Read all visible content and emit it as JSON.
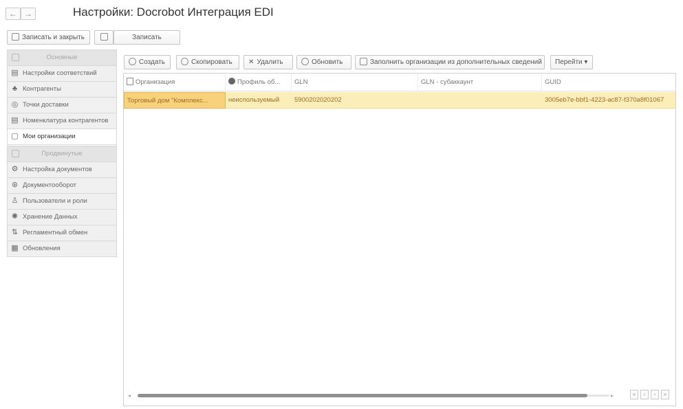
{
  "window": {
    "title": "Настройки: Docrobot Интеграция EDI",
    "back_glyph": "←",
    "forward_glyph": "→"
  },
  "commandbar": {
    "save_close_label": "Записать и закрыть",
    "save_label": "Записать"
  },
  "sidebar": {
    "items": [
      {
        "label": "Основные",
        "icon": "group-icon",
        "kind": "group"
      },
      {
        "label": "Настройки соответствий",
        "icon": "document-icon"
      },
      {
        "label": "Контрагенты",
        "icon": "people-icon"
      },
      {
        "label": "Точки доставки",
        "icon": "location-icon"
      },
      {
        "label": "Номенклатура контрагентов",
        "icon": "document-icon"
      },
      {
        "label": "Мои организации",
        "icon": "document-icon",
        "active": true
      },
      {
        "label": "Продвинутые",
        "icon": "group-icon",
        "kind": "group"
      },
      {
        "label": "Настройка документов",
        "icon": "document-settings-icon"
      },
      {
        "label": "Документооборот",
        "icon": "gear-icon"
      },
      {
        "label": "Пользователи и роли",
        "icon": "user-icon"
      },
      {
        "label": "Хранение Данных",
        "icon": "database-icon"
      },
      {
        "label": "Регламентный обмен",
        "icon": "exchange-icon"
      },
      {
        "label": "Обновления",
        "icon": "update-icon"
      }
    ]
  },
  "toolbar": {
    "create_label": "Создать",
    "copy_label": "Скопировать",
    "delete_label": "Удалить",
    "refresh_label": "Обновить",
    "fill_label": "Заполнить организации из дополнительных сведений",
    "goto_label": "Перейти ▾"
  },
  "table": {
    "columns": [
      "Организация",
      "Профиль об...",
      "GLN",
      "GLN - субаккаунт",
      "GUID"
    ],
    "rows": [
      [
        "Торговый дом \"Комплекс...",
        "неиспользуемый",
        "5900202020202",
        "",
        "3005eb7e-bbf1-4223-ac87-f370a8f01067"
      ]
    ]
  },
  "pager": {
    "glyphs": [
      "«",
      "‹",
      "›",
      "»"
    ]
  },
  "colors": {
    "row_selected": "#fbeeb9",
    "cell_focused": "#f7d27a",
    "row_text": "#a06a28"
  }
}
